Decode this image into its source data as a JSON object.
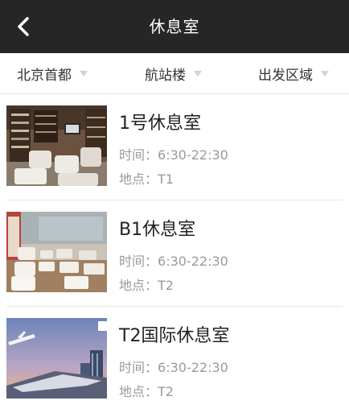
{
  "header": {
    "title": "休息室",
    "back_icon": "chevron-left-icon"
  },
  "filters": [
    {
      "label": "北京首都"
    },
    {
      "label": "航站楼"
    },
    {
      "label": "出发区域"
    }
  ],
  "time_label": "时间：",
  "location_label": "地点：",
  "lounges": [
    {
      "name": "1号休息室",
      "time": "6:30-22:30",
      "location": "T1"
    },
    {
      "name": "B1休息室",
      "time": "6:30-22:30",
      "location": "T2"
    },
    {
      "name": "T2国际休息室",
      "time": "6:30-22:30",
      "location": "T2"
    }
  ],
  "colors": {
    "header_bg": "#262626",
    "header_text": "#ffffff",
    "primary_text": "#222222",
    "secondary_text": "#9a9a9a",
    "caret": "#d2d2d2"
  }
}
